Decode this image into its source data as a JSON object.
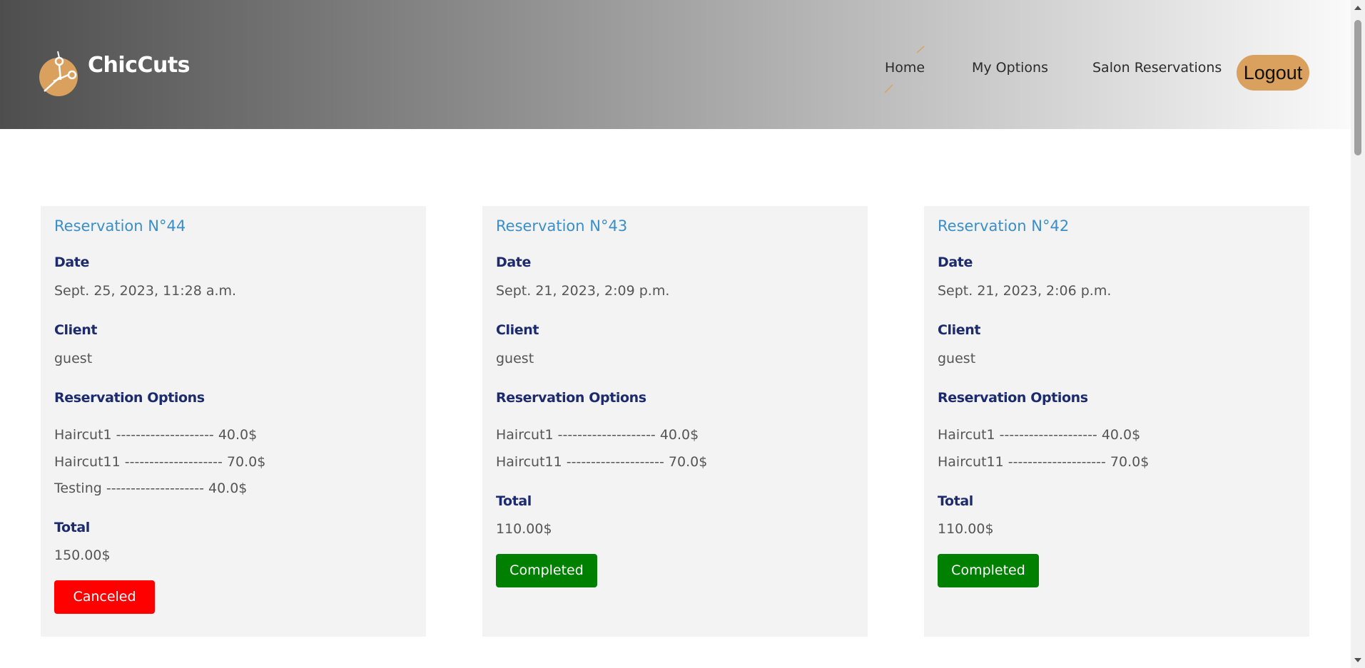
{
  "header": {
    "brand": "ChicCuts",
    "nav": {
      "home": "Home",
      "my_options": "My Options",
      "salon_reservations": "Salon Reservations",
      "logout": "Logout"
    }
  },
  "labels": {
    "date": "Date",
    "client": "Client",
    "options": "Reservation Options",
    "total": "Total"
  },
  "reservations": [
    {
      "title": "Reservation N°44",
      "date": "Sept. 25, 2023, 11:28 a.m.",
      "client": "guest",
      "options": [
        "Haircut1 -------------------- 40.0$",
        "Haircut11 -------------------- 70.0$",
        "Testing -------------------- 40.0$"
      ],
      "total": "150.00$",
      "status": "Canceled"
    },
    {
      "title": "Reservation N°43",
      "date": "Sept. 21, 2023, 2:09 p.m.",
      "client": "guest",
      "options": [
        "Haircut1 -------------------- 40.0$",
        "Haircut11 -------------------- 70.0$"
      ],
      "total": "110.00$",
      "status": "Completed"
    },
    {
      "title": "Reservation N°42",
      "date": "Sept. 21, 2023, 2:06 p.m.",
      "client": "guest",
      "options": [
        "Haircut1 -------------------- 40.0$",
        "Haircut11 -------------------- 70.0$"
      ],
      "total": "110.00$",
      "status": "Completed"
    }
  ],
  "colors": {
    "accent": "#d9a05e",
    "title_blue": "#3a8fc9",
    "label_navy": "#1c2a6e",
    "canceled": "#ff0000",
    "completed": "#008000"
  },
  "icons": {
    "logo": "scissors-logo-icon"
  }
}
